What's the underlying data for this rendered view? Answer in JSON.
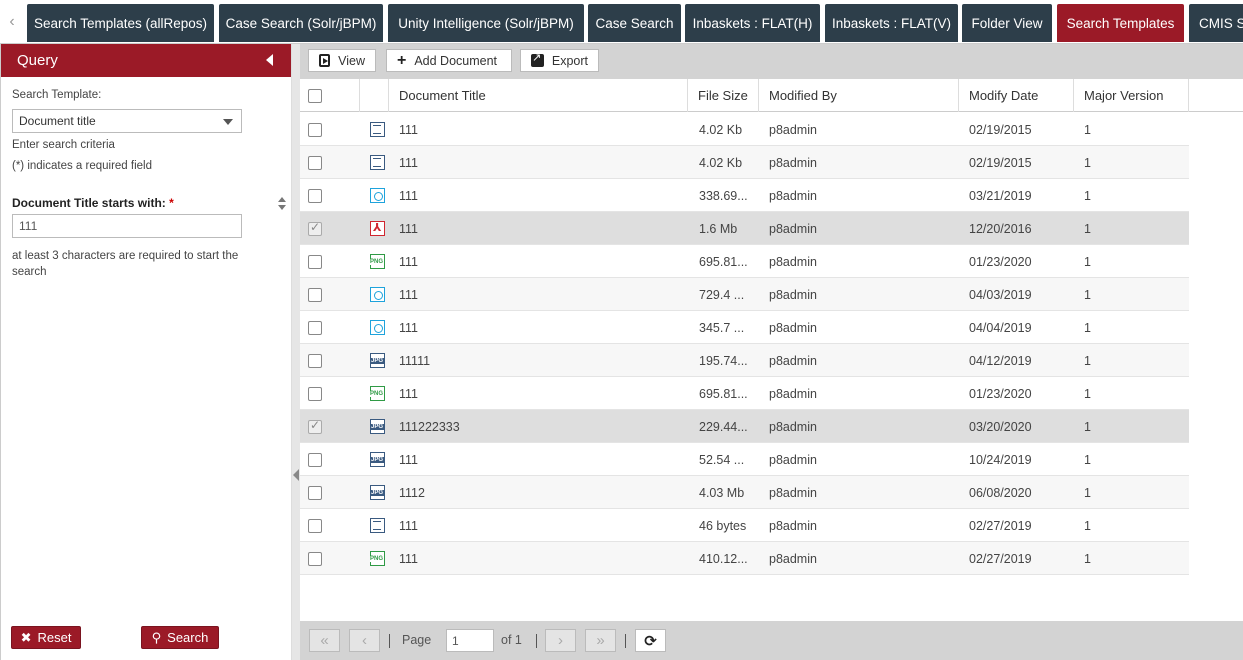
{
  "tabs": [
    {
      "label": "Search Templates (allRepos)",
      "active": false
    },
    {
      "label": "Case Search (Solr/jBPM)",
      "active": false
    },
    {
      "label": "Unity Intelligence (Solr/jBPM)",
      "active": false
    },
    {
      "label": "Case Search",
      "active": false
    },
    {
      "label": "Inbaskets : FLAT(H)",
      "active": false
    },
    {
      "label": "Inbaskets : FLAT(V)",
      "active": false
    },
    {
      "label": "Folder View",
      "active": false
    },
    {
      "label": "Search Templates",
      "active": true
    },
    {
      "label": "CMIS Se",
      "active": false
    }
  ],
  "query": {
    "title": "Query",
    "template_label": "Search Template:",
    "template_value": "Document title",
    "enter_criteria": "Enter search criteria",
    "required_note": "(*) indicates a required field",
    "field_label": "Document Title starts with:",
    "field_required_mark": "*",
    "field_value": "111",
    "hint": "at least 3 characters are required to start the search",
    "reset_label": "Reset",
    "search_label": "Search"
  },
  "toolbar": {
    "view_label": "View",
    "add_label": "Add Document",
    "export_label": "Export"
  },
  "columns": {
    "title": "Document Title",
    "size": "File Size",
    "modified_by": "Modified By",
    "modify_date": "Modify Date",
    "major_version": "Major Version"
  },
  "rows": [
    {
      "icon": "doc",
      "title": "111",
      "size": "4.02 Kb",
      "modified_by": "p8admin",
      "date": "02/19/2015",
      "version": "1",
      "checked": false
    },
    {
      "icon": "doc",
      "title": "111",
      "size": "4.02 Kb",
      "modified_by": "p8admin",
      "date": "02/19/2015",
      "version": "1",
      "checked": false
    },
    {
      "icon": "img",
      "title": "111",
      "size": "338.69...",
      "modified_by": "p8admin",
      "date": "03/21/2019",
      "version": "1",
      "checked": false
    },
    {
      "icon": "pdf",
      "title": "111",
      "size": "1.6 Mb",
      "modified_by": "p8admin",
      "date": "12/20/2016",
      "version": "1",
      "checked": true
    },
    {
      "icon": "png",
      "title": "111",
      "size": "695.81...",
      "modified_by": "p8admin",
      "date": "01/23/2020",
      "version": "1",
      "checked": false
    },
    {
      "icon": "img",
      "title": "111",
      "size": "729.4 ...",
      "modified_by": "p8admin",
      "date": "04/03/2019",
      "version": "1",
      "checked": false
    },
    {
      "icon": "img",
      "title": "111",
      "size": "345.7 ...",
      "modified_by": "p8admin",
      "date": "04/04/2019",
      "version": "1",
      "checked": false
    },
    {
      "icon": "jpg",
      "title": "11111",
      "size": "195.74...",
      "modified_by": "p8admin",
      "date": "04/12/2019",
      "version": "1",
      "checked": false
    },
    {
      "icon": "png",
      "title": "111",
      "size": "695.81...",
      "modified_by": "p8admin",
      "date": "01/23/2020",
      "version": "1",
      "checked": false
    },
    {
      "icon": "jpg",
      "title": "111222333",
      "size": "229.44...",
      "modified_by": "p8admin",
      "date": "03/20/2020",
      "version": "1",
      "checked": true
    },
    {
      "icon": "jpg",
      "title": "111",
      "size": "52.54 ...",
      "modified_by": "p8admin",
      "date": "10/24/2019",
      "version": "1",
      "checked": false
    },
    {
      "icon": "jpg",
      "title": "1112",
      "size": "4.03 Mb",
      "modified_by": "p8admin",
      "date": "06/08/2020",
      "version": "1",
      "checked": false
    },
    {
      "icon": "doc",
      "title": "111",
      "size": "46 bytes",
      "modified_by": "p8admin",
      "date": "02/27/2019",
      "version": "1",
      "checked": false
    },
    {
      "icon": "png",
      "title": "111",
      "size": "410.12...",
      "modified_by": "p8admin",
      "date": "02/27/2019",
      "version": "1",
      "checked": false
    }
  ],
  "pager": {
    "page_label": "Page",
    "page_value": "1",
    "of_label": "of 1"
  },
  "colors": {
    "accent": "#9b1a27",
    "tab_dark": "#2d3e4a"
  }
}
